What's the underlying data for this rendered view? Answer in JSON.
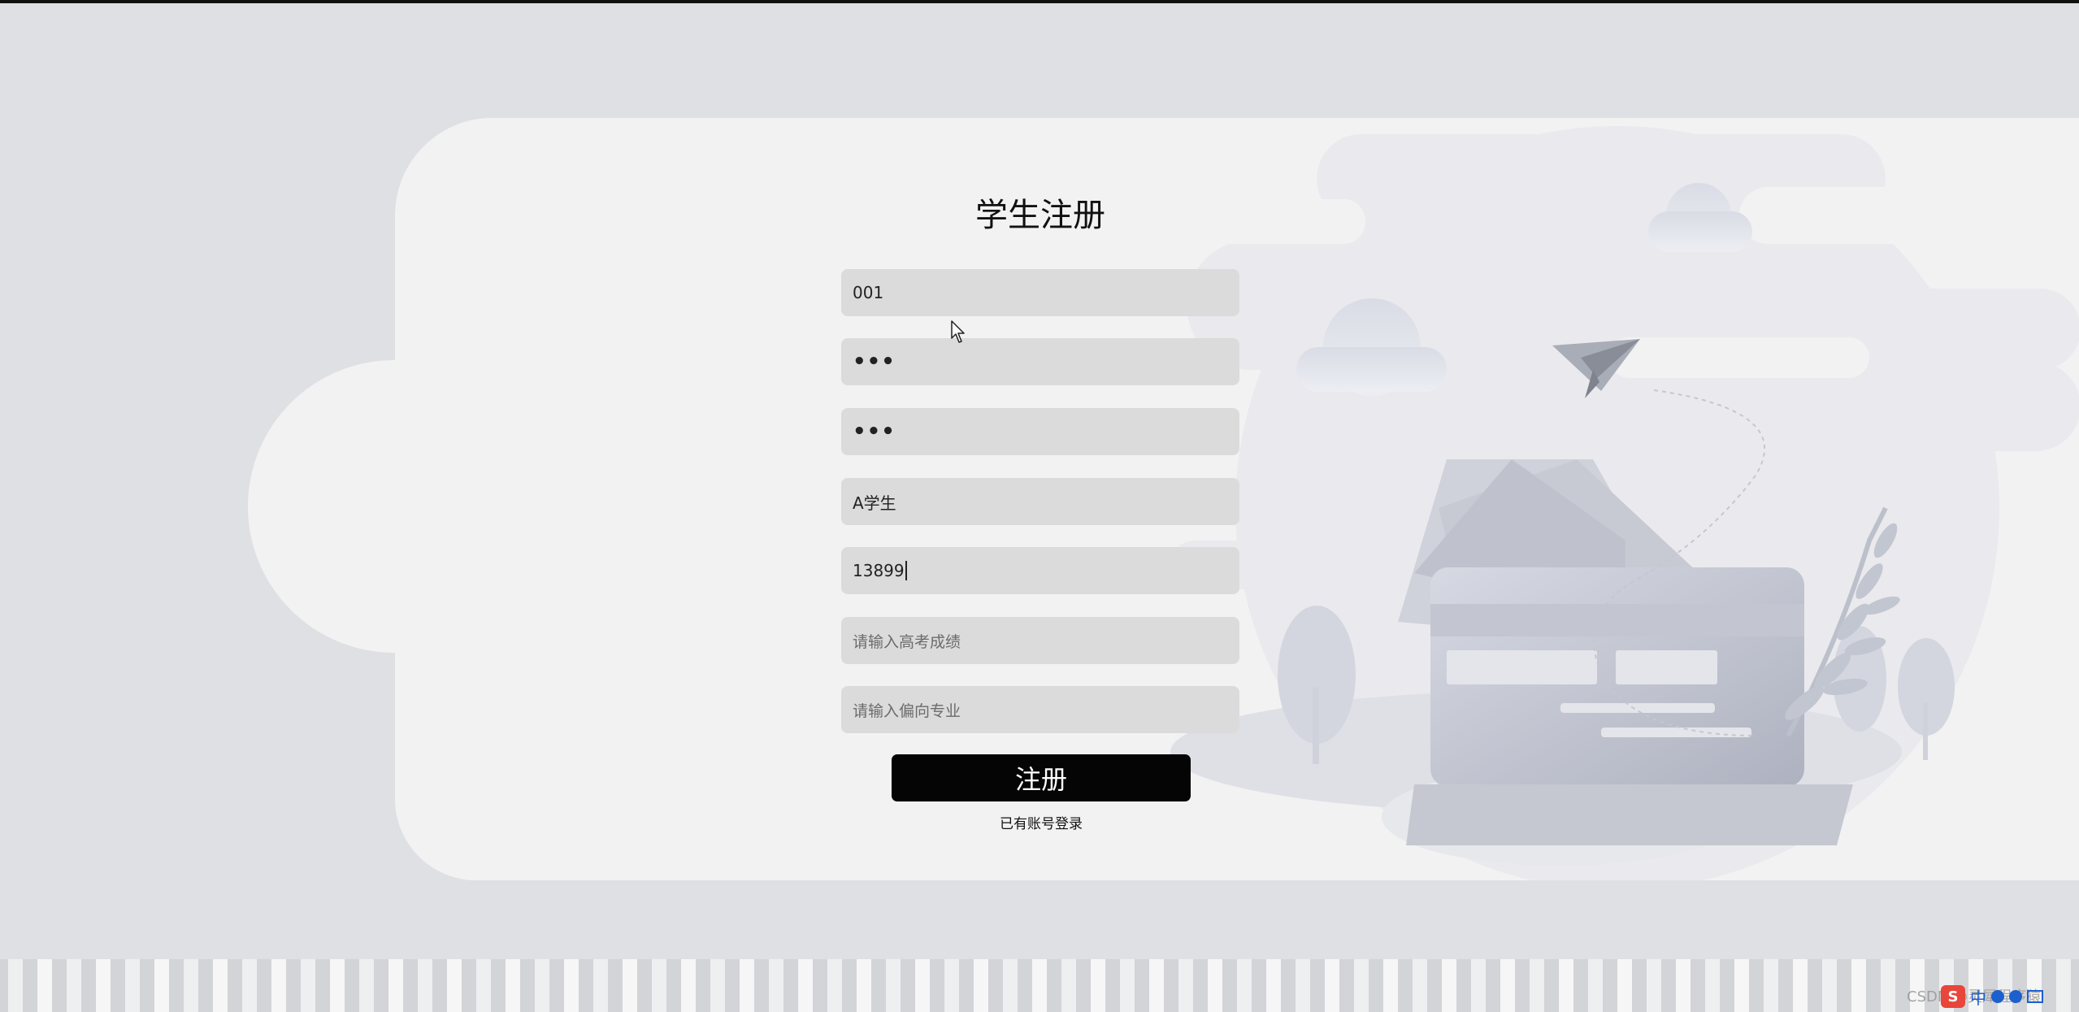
{
  "register": {
    "title": "学生注册",
    "fields": [
      {
        "value": "001",
        "placeholder": ""
      },
      {
        "value": "•••",
        "placeholder": ""
      },
      {
        "value": "•••",
        "placeholder": ""
      },
      {
        "value": "A学生",
        "placeholder": ""
      },
      {
        "value": "13899",
        "placeholder": ""
      },
      {
        "value": "",
        "placeholder": "请输入高考成绩"
      },
      {
        "value": "",
        "placeholder": "请输入偏向专业"
      }
    ],
    "submit_label": "注册",
    "login_link": "已有账号登录"
  },
  "watermark": {
    "text": "CSDN @灵犀程序猿"
  },
  "tray": {
    "sogou_label": "S",
    "ime_label": "中"
  },
  "colors": {
    "page_bg": "#dfe0e3",
    "card_bg": "#f2f2f2",
    "field_bg": "#dcdbdc",
    "button_bg": "#050505",
    "button_text": "#ffffff",
    "illustration": "#c9ccd6"
  }
}
